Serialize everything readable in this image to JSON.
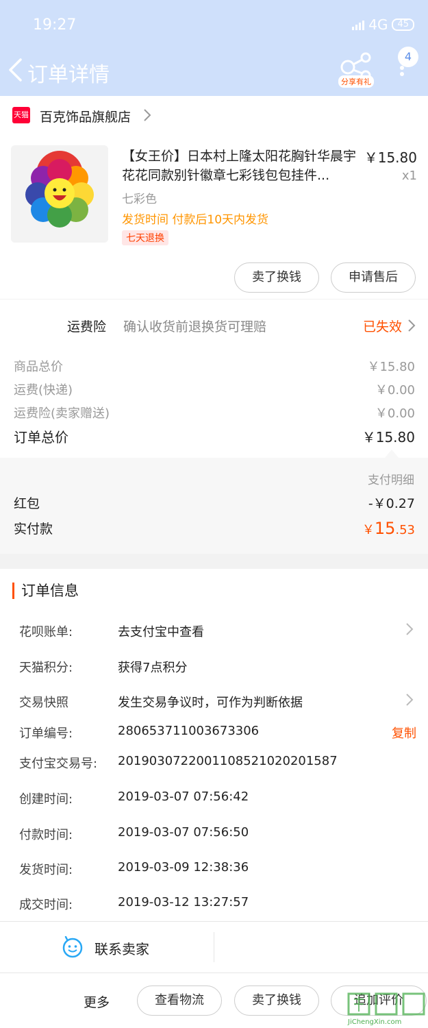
{
  "status_bar": {
    "time": "19:27",
    "network": "4G",
    "battery": "45"
  },
  "header": {
    "title": "订单详情",
    "share_badge": "分享有礼",
    "message_count": "4"
  },
  "store": {
    "logo_text": "天猫",
    "name": "百克饰品旗舰店"
  },
  "product": {
    "title": "【女王价】日本村上隆太阳花胸针华晨宇花花同款别针徽章七彩钱包包挂件...",
    "price": "￥15.80",
    "quantity": "x1",
    "sku": "七彩色",
    "shipping_note": "发货时间 付款后10天内发货",
    "return_tag": "七天退换",
    "btn_sell": "卖了换钱",
    "btn_aftersale": "申请售后"
  },
  "insurance": {
    "label": "运费险",
    "desc": "确认收货前退换货可理赔",
    "status": "已失效"
  },
  "fees": [
    {
      "label": "商品总价",
      "value": "￥15.80"
    },
    {
      "label": "运费(快递)",
      "value": "￥0.00"
    },
    {
      "label": "运费险(卖家赠送)",
      "value": "￥0.00"
    }
  ],
  "order_total": {
    "label": "订单总价",
    "value": "￥15.80"
  },
  "payment": {
    "detail_label": "支付明细",
    "red_packet_label": "红包",
    "red_packet_value": "-￥0.27",
    "actual_label": "实付款",
    "actual_currency": "￥",
    "actual_integer": "15",
    "actual_decimal": ".53"
  },
  "order_info": {
    "title": "订单信息",
    "rows": [
      {
        "key": "花呗账单:",
        "value": "去支付宝中查看"
      },
      {
        "key": "天猫积分:",
        "value": "获得7点积分"
      },
      {
        "key": "交易快照",
        "value": "发生交易争议时，可作为判断依据"
      },
      {
        "key": "订单编号:",
        "value": "280653711003673306"
      },
      {
        "key": "支付宝交易号:",
        "value": "2019030722001108521020201587"
      },
      {
        "key": "创建时间:",
        "value": "2019-03-07 07:56:42"
      },
      {
        "key": "付款时间:",
        "value": "2019-03-07 07:56:50"
      },
      {
        "key": "发货时间:",
        "value": "2019-03-09 12:38:36"
      },
      {
        "key": "成交时间:",
        "value": "2019-03-12 13:27:57"
      }
    ],
    "copy_label": "复制"
  },
  "contact": {
    "label": "联系卖家"
  },
  "bottom": {
    "more_label": "更多",
    "btn_logistics": "查看物流",
    "btn_sell": "卖了换钱",
    "btn_review": "追加评价"
  },
  "watermark": {
    "text": "JiChengXin.com"
  }
}
